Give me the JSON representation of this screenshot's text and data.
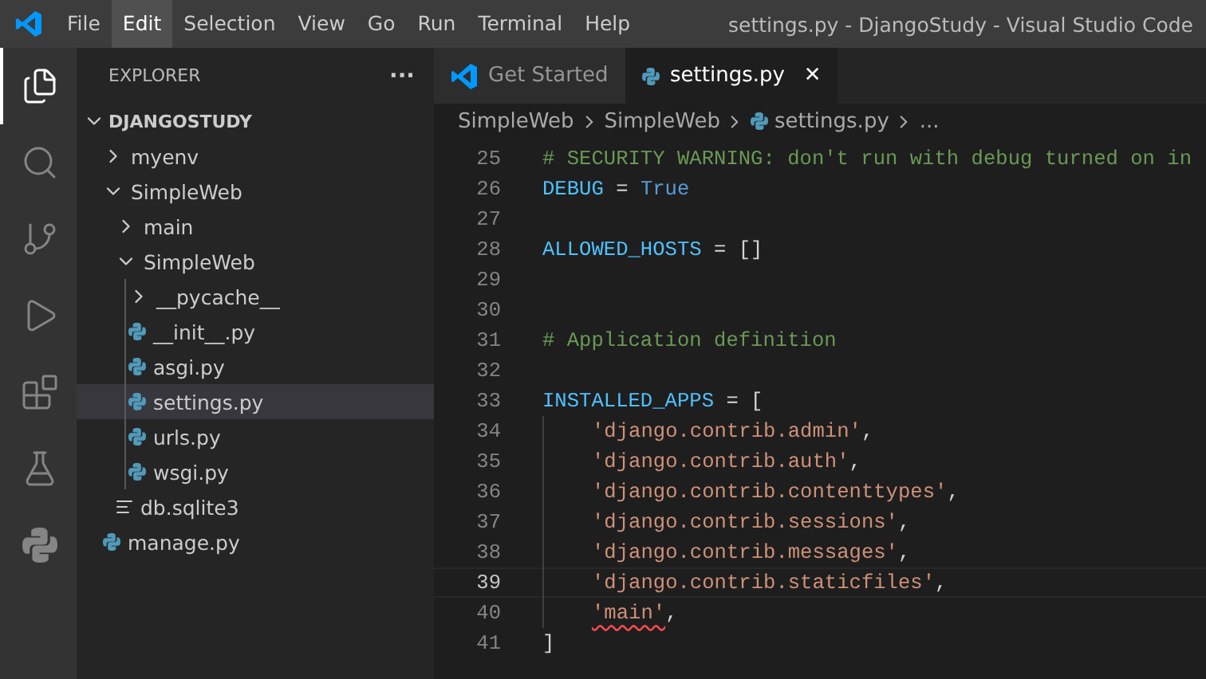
{
  "menu": [
    {
      "label": "File",
      "selected": false
    },
    {
      "label": "Edit",
      "selected": true
    },
    {
      "label": "Selection",
      "selected": false
    },
    {
      "label": "View",
      "selected": false
    },
    {
      "label": "Go",
      "selected": false
    },
    {
      "label": "Run",
      "selected": false
    },
    {
      "label": "Terminal",
      "selected": false
    },
    {
      "label": "Help",
      "selected": false
    }
  ],
  "window": {
    "title": "settings.py - DjangoStudy - Visual Studio Code"
  },
  "activity_bar": [
    {
      "kind": "files",
      "selected": true
    },
    {
      "kind": "search",
      "selected": false
    },
    {
      "kind": "source-control",
      "selected": false
    },
    {
      "kind": "run",
      "selected": false
    },
    {
      "kind": "extensions",
      "selected": false
    },
    {
      "kind": "testing",
      "selected": false
    },
    {
      "kind": "python",
      "selected": false
    }
  ],
  "sidebar": {
    "title": "EXPLORER",
    "more": "···",
    "root": {
      "label": "DJANGOSTUDY",
      "expanded": true
    },
    "tree": [
      {
        "label": "myenv",
        "kind": "folder",
        "expanded": false,
        "selected": false
      },
      {
        "label": "SimpleWeb",
        "kind": "folder",
        "expanded": true,
        "selected": false,
        "children": [
          {
            "label": "main",
            "kind": "folder",
            "expanded": false,
            "selected": false
          },
          {
            "label": "SimpleWeb",
            "kind": "folder",
            "expanded": true,
            "selected": false,
            "children": [
              {
                "label": "__pycache__",
                "kind": "folder",
                "expanded": false,
                "selected": false
              },
              {
                "label": "__init__.py",
                "kind": "python",
                "selected": false
              },
              {
                "label": "asgi.py",
                "kind": "python",
                "selected": false
              },
              {
                "label": "settings.py",
                "kind": "python",
                "selected": true
              },
              {
                "label": "urls.py",
                "kind": "python",
                "selected": false
              },
              {
                "label": "wsgi.py",
                "kind": "python",
                "selected": false
              }
            ]
          },
          {
            "label": "db.sqlite3",
            "kind": "text",
            "selected": false
          }
        ]
      },
      {
        "label": "manage.py",
        "kind": "python",
        "selected": false
      }
    ]
  },
  "tabs": [
    {
      "label": "Get Started",
      "kind": "welcome",
      "selected": false
    },
    {
      "label": "settings.py",
      "kind": "python",
      "selected": true,
      "close": "✕"
    }
  ],
  "breadcrumb": [
    {
      "label": "SimpleWeb",
      "kind": "folder"
    },
    {
      "label": "SimpleWeb",
      "kind": "folder"
    },
    {
      "label": "settings.py",
      "kind": "python"
    },
    {
      "label": "...",
      "kind": "more"
    }
  ],
  "code": [
    {
      "number": "25",
      "current": false,
      "indent": false,
      "tokens": [
        {
          "kind": "comment",
          "text": "# SECURITY WARNING: don't run with debug turned on in"
        }
      ]
    },
    {
      "number": "26",
      "current": false,
      "indent": false,
      "tokens": [
        {
          "kind": "var",
          "text": "DEBUG"
        },
        {
          "kind": "op",
          "text": " = "
        },
        {
          "kind": "const",
          "text": "True"
        }
      ]
    },
    {
      "number": "27",
      "current": false,
      "indent": false
    },
    {
      "number": "28",
      "current": false,
      "indent": false,
      "tokens": [
        {
          "kind": "var",
          "text": "ALLOWED_HOSTS"
        },
        {
          "kind": "op",
          "text": " = []"
        }
      ]
    },
    {
      "number": "29",
      "current": false,
      "indent": false
    },
    {
      "number": "30",
      "current": false,
      "indent": false
    },
    {
      "number": "31",
      "current": false,
      "indent": false,
      "tokens": [
        {
          "kind": "comment",
          "text": "# Application definition"
        }
      ]
    },
    {
      "number": "32",
      "current": false,
      "indent": false
    },
    {
      "number": "33",
      "current": false,
      "indent": false,
      "tokens": [
        {
          "kind": "var",
          "text": "INSTALLED_APPS"
        },
        {
          "kind": "op",
          "text": " = ["
        }
      ]
    },
    {
      "number": "34",
      "current": false,
      "indent": true,
      "tokens": [
        {
          "kind": "string",
          "text": "'django.contrib.admin'"
        },
        {
          "kind": "op",
          "text": ","
        }
      ]
    },
    {
      "number": "35",
      "current": false,
      "indent": true,
      "tokens": [
        {
          "kind": "string",
          "text": "'django.contrib.auth'"
        },
        {
          "kind": "op",
          "text": ","
        }
      ]
    },
    {
      "number": "36",
      "current": false,
      "indent": true,
      "tokens": [
        {
          "kind": "string",
          "text": "'django.contrib.contenttypes'"
        },
        {
          "kind": "op",
          "text": ","
        }
      ]
    },
    {
      "number": "37",
      "current": false,
      "indent": true,
      "tokens": [
        {
          "kind": "string",
          "text": "'django.contrib.sessions'"
        },
        {
          "kind": "op",
          "text": ","
        }
      ]
    },
    {
      "number": "38",
      "current": false,
      "indent": true,
      "tokens": [
        {
          "kind": "string",
          "text": "'django.contrib.messages'"
        },
        {
          "kind": "op",
          "text": ","
        }
      ]
    },
    {
      "number": "39",
      "current": true,
      "indent": true,
      "tokens": [
        {
          "kind": "string",
          "text": "'django.contrib.staticfiles'"
        },
        {
          "kind": "op",
          "text": ","
        }
      ]
    },
    {
      "number": "40",
      "current": false,
      "indent": true,
      "tokens": [
        {
          "kind": "string",
          "text": "'main'",
          "error": true
        },
        {
          "kind": "op",
          "text": ","
        }
      ]
    },
    {
      "number": "41",
      "current": false,
      "indent": false,
      "tokens": [
        {
          "kind": "op",
          "text": "]"
        }
      ]
    }
  ]
}
